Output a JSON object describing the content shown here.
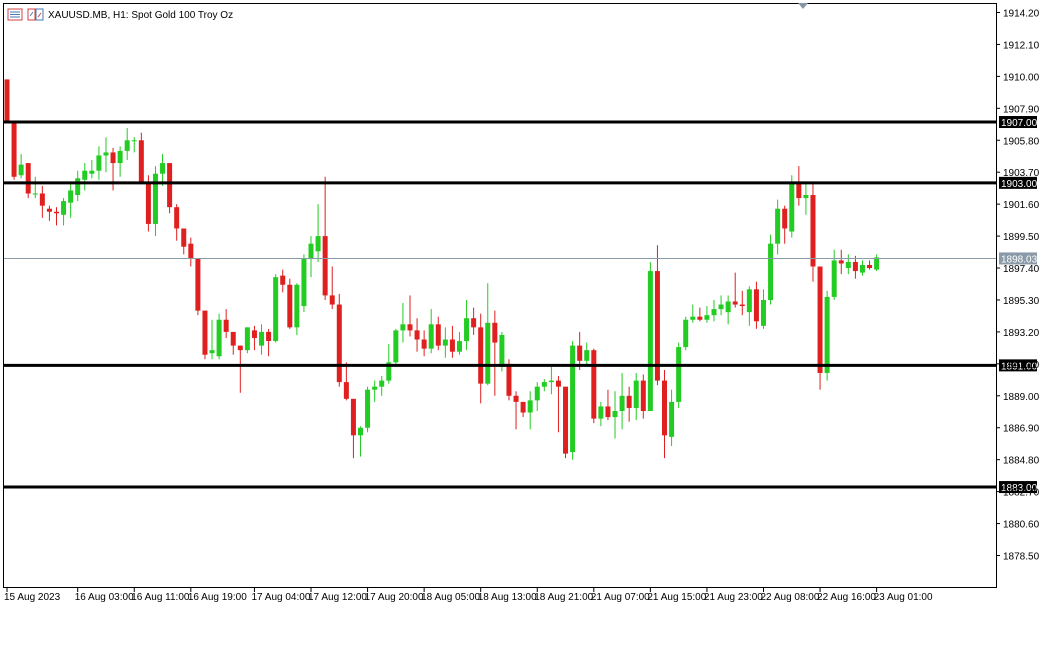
{
  "header": {
    "symbol_title": "XAUUSD.MB, H1:  Spot Gold 100 Troy Oz"
  },
  "colors": {
    "bull": "#22cc22",
    "bear": "#e01f1f",
    "wick_bull": "#22cc22",
    "wick_bear": "#e01f1f",
    "grid_border": "#000000",
    "bid_line": "#8a9aa8"
  },
  "chart_data": {
    "type": "candlestick",
    "title": "XAUUSD.MB, H1:  Spot Gold 100 Troy Oz",
    "ylim": [
      1876.0,
      1915.0
    ],
    "price_ticks": [
      "1914.20",
      "1912.10",
      "1910.00",
      "1907.90",
      "1905.80",
      "1903.70",
      "1901.60",
      "1899.50",
      "1897.40",
      "1895.30",
      "1893.20",
      "1891.10",
      "1889.00",
      "1886.90",
      "1884.80",
      "1882.70",
      "1880.60",
      "1878.50"
    ],
    "time_ticks": [
      {
        "label": "15 Aug 2023",
        "i": 0
      },
      {
        "label": "16 Aug 03:00",
        "i": 10
      },
      {
        "label": "16 Aug 11:00",
        "i": 18
      },
      {
        "label": "16 Aug 19:00",
        "i": 26
      },
      {
        "label": "17 Aug 04:00",
        "i": 35
      },
      {
        "label": "17 Aug 12:00",
        "i": 43
      },
      {
        "label": "17 Aug 20:00",
        "i": 51
      },
      {
        "label": "18 Aug 05:00",
        "i": 59
      },
      {
        "label": "18 Aug 13:00",
        "i": 67
      },
      {
        "label": "18 Aug 21:00",
        "i": 75
      },
      {
        "label": "21 Aug 07:00",
        "i": 83
      },
      {
        "label": "21 Aug 15:00",
        "i": 91
      },
      {
        "label": "21 Aug 23:00",
        "i": 99
      },
      {
        "label": "22 Aug 08:00",
        "i": 107
      },
      {
        "label": "22 Aug 16:00",
        "i": 115
      },
      {
        "label": "23 Aug 01:00",
        "i": 123
      }
    ],
    "horizontal_lines": [
      {
        "price": 1907.0,
        "label": "1907.00",
        "style": "level"
      },
      {
        "price": 1903.0,
        "label": "1903.00",
        "style": "level"
      },
      {
        "price": 1891.0,
        "label": "1891.00",
        "style": "level"
      },
      {
        "price": 1883.0,
        "label": "1883.00",
        "style": "level"
      },
      {
        "price": 1898.03,
        "label": "1898.03",
        "style": "bid"
      }
    ],
    "candles": [
      {
        "o": 1909.8,
        "h": 1909.8,
        "l": 1907.0,
        "c": 1907.0
      },
      {
        "o": 1907.0,
        "h": 1907.0,
        "l": 1903.2,
        "c": 1903.4
      },
      {
        "o": 1903.5,
        "h": 1904.9,
        "l": 1903.3,
        "c": 1904.2
      },
      {
        "o": 1904.3,
        "h": 1904.3,
        "l": 1902.0,
        "c": 1902.3
      },
      {
        "o": 1902.3,
        "h": 1903.4,
        "l": 1902.0,
        "c": 1902.3
      },
      {
        "o": 1902.3,
        "h": 1902.8,
        "l": 1900.7,
        "c": 1901.5
      },
      {
        "o": 1901.3,
        "h": 1901.5,
        "l": 1900.5,
        "c": 1901.1
      },
      {
        "o": 1901.1,
        "h": 1901.4,
        "l": 1900.2,
        "c": 1901.0
      },
      {
        "o": 1900.9,
        "h": 1902.0,
        "l": 1900.2,
        "c": 1901.8
      },
      {
        "o": 1901.7,
        "h": 1903.0,
        "l": 1900.7,
        "c": 1902.5
      },
      {
        "o": 1902.2,
        "h": 1903.8,
        "l": 1901.8,
        "c": 1903.3
      },
      {
        "o": 1903.2,
        "h": 1904.3,
        "l": 1902.5,
        "c": 1903.8
      },
      {
        "o": 1903.6,
        "h": 1904.5,
        "l": 1903.3,
        "c": 1903.8
      },
      {
        "o": 1903.8,
        "h": 1905.4,
        "l": 1903.2,
        "c": 1904.8
      },
      {
        "o": 1904.8,
        "h": 1906.0,
        "l": 1903.7,
        "c": 1905.0
      },
      {
        "o": 1905.0,
        "h": 1905.3,
        "l": 1902.5,
        "c": 1904.3
      },
      {
        "o": 1904.3,
        "h": 1905.4,
        "l": 1903.4,
        "c": 1905.1
      },
      {
        "o": 1905.1,
        "h": 1906.6,
        "l": 1904.5,
        "c": 1905.8
      },
      {
        "o": 1905.8,
        "h": 1906.0,
        "l": 1905.0,
        "c": 1905.8
      },
      {
        "o": 1905.8,
        "h": 1906.3,
        "l": 1902.9,
        "c": 1903.0
      },
      {
        "o": 1903.0,
        "h": 1903.5,
        "l": 1899.8,
        "c": 1900.3
      },
      {
        "o": 1900.3,
        "h": 1904.1,
        "l": 1899.5,
        "c": 1903.6
      },
      {
        "o": 1903.6,
        "h": 1904.9,
        "l": 1902.8,
        "c": 1904.3
      },
      {
        "o": 1904.3,
        "h": 1904.3,
        "l": 1901.0,
        "c": 1901.4
      },
      {
        "o": 1901.4,
        "h": 1901.6,
        "l": 1899.2,
        "c": 1900.0
      },
      {
        "o": 1900.0,
        "h": 1900.0,
        "l": 1898.3,
        "c": 1898.8
      },
      {
        "o": 1899.0,
        "h": 1899.4,
        "l": 1897.5,
        "c": 1898.0
      },
      {
        "o": 1898.0,
        "h": 1898.0,
        "l": 1894.3,
        "c": 1894.6
      },
      {
        "o": 1894.6,
        "h": 1894.6,
        "l": 1891.4,
        "c": 1891.7
      },
      {
        "o": 1891.8,
        "h": 1894.0,
        "l": 1891.4,
        "c": 1892.0
      },
      {
        "o": 1891.6,
        "h": 1894.4,
        "l": 1891.4,
        "c": 1894.0
      },
      {
        "o": 1894.0,
        "h": 1894.7,
        "l": 1892.8,
        "c": 1893.2
      },
      {
        "o": 1893.2,
        "h": 1893.2,
        "l": 1891.7,
        "c": 1892.3
      },
      {
        "o": 1892.3,
        "h": 1892.3,
        "l": 1889.2,
        "c": 1892.0
      },
      {
        "o": 1892.0,
        "h": 1893.5,
        "l": 1891.8,
        "c": 1893.5
      },
      {
        "o": 1893.3,
        "h": 1893.6,
        "l": 1892.0,
        "c": 1892.8
      },
      {
        "o": 1892.3,
        "h": 1893.7,
        "l": 1891.7,
        "c": 1893.2
      },
      {
        "o": 1893.2,
        "h": 1893.4,
        "l": 1891.6,
        "c": 1892.6
      },
      {
        "o": 1892.6,
        "h": 1897.0,
        "l": 1892.5,
        "c": 1896.8
      },
      {
        "o": 1896.9,
        "h": 1897.3,
        "l": 1895.8,
        "c": 1896.3
      },
      {
        "o": 1896.3,
        "h": 1896.7,
        "l": 1893.4,
        "c": 1893.5
      },
      {
        "o": 1893.5,
        "h": 1896.4,
        "l": 1893.0,
        "c": 1896.3
      },
      {
        "o": 1894.9,
        "h": 1898.3,
        "l": 1894.5,
        "c": 1898.0
      },
      {
        "o": 1898.0,
        "h": 1899.5,
        "l": 1896.8,
        "c": 1899.0
      },
      {
        "o": 1898.5,
        "h": 1901.6,
        "l": 1897.8,
        "c": 1899.5
      },
      {
        "o": 1899.5,
        "h": 1903.4,
        "l": 1895.3,
        "c": 1895.6
      },
      {
        "o": 1895.6,
        "h": 1897.5,
        "l": 1894.7,
        "c": 1895.0
      },
      {
        "o": 1895.0,
        "h": 1895.7,
        "l": 1889.6,
        "c": 1889.9
      },
      {
        "o": 1889.9,
        "h": 1891.2,
        "l": 1888.7,
        "c": 1888.8
      },
      {
        "o": 1888.8,
        "h": 1888.8,
        "l": 1884.9,
        "c": 1886.4
      },
      {
        "o": 1886.4,
        "h": 1887.0,
        "l": 1885.0,
        "c": 1886.9
      },
      {
        "o": 1886.9,
        "h": 1889.6,
        "l": 1886.6,
        "c": 1889.4
      },
      {
        "o": 1889.4,
        "h": 1890.0,
        "l": 1888.6,
        "c": 1889.6
      },
      {
        "o": 1889.6,
        "h": 1890.3,
        "l": 1889.0,
        "c": 1890.0
      },
      {
        "o": 1890.0,
        "h": 1892.4,
        "l": 1889.8,
        "c": 1891.2
      },
      {
        "o": 1891.2,
        "h": 1893.4,
        "l": 1890.9,
        "c": 1893.3
      },
      {
        "o": 1893.3,
        "h": 1895.1,
        "l": 1892.5,
        "c": 1893.7
      },
      {
        "o": 1893.7,
        "h": 1895.6,
        "l": 1892.9,
        "c": 1893.3
      },
      {
        "o": 1893.3,
        "h": 1894.1,
        "l": 1891.9,
        "c": 1892.7
      },
      {
        "o": 1892.7,
        "h": 1893.3,
        "l": 1891.6,
        "c": 1892.1
      },
      {
        "o": 1892.1,
        "h": 1894.7,
        "l": 1891.8,
        "c": 1893.7
      },
      {
        "o": 1893.7,
        "h": 1894.2,
        "l": 1892.0,
        "c": 1892.3
      },
      {
        "o": 1892.3,
        "h": 1893.5,
        "l": 1891.5,
        "c": 1892.7
      },
      {
        "o": 1892.7,
        "h": 1893.6,
        "l": 1891.5,
        "c": 1891.9
      },
      {
        "o": 1891.9,
        "h": 1893.2,
        "l": 1891.7,
        "c": 1892.6
      },
      {
        "o": 1892.6,
        "h": 1895.3,
        "l": 1892.0,
        "c": 1894.1
      },
      {
        "o": 1894.1,
        "h": 1894.8,
        "l": 1893.0,
        "c": 1893.5
      },
      {
        "o": 1893.5,
        "h": 1894.4,
        "l": 1888.5,
        "c": 1889.8
      },
      {
        "o": 1889.8,
        "h": 1896.4,
        "l": 1889.7,
        "c": 1893.8
      },
      {
        "o": 1893.8,
        "h": 1894.6,
        "l": 1889.0,
        "c": 1892.5
      },
      {
        "o": 1890.9,
        "h": 1893.2,
        "l": 1890.6,
        "c": 1893.0
      },
      {
        "o": 1891.1,
        "h": 1891.4,
        "l": 1888.7,
        "c": 1889.0
      },
      {
        "o": 1889.0,
        "h": 1889.3,
        "l": 1886.8,
        "c": 1888.6
      },
      {
        "o": 1888.6,
        "h": 1888.6,
        "l": 1887.6,
        "c": 1887.9
      },
      {
        "o": 1887.9,
        "h": 1889.3,
        "l": 1886.8,
        "c": 1888.7
      },
      {
        "o": 1888.7,
        "h": 1889.9,
        "l": 1888.0,
        "c": 1889.6
      },
      {
        "o": 1889.6,
        "h": 1890.1,
        "l": 1889.3,
        "c": 1889.9
      },
      {
        "o": 1889.9,
        "h": 1890.9,
        "l": 1889.1,
        "c": 1890.0
      },
      {
        "o": 1890.0,
        "h": 1890.3,
        "l": 1886.6,
        "c": 1889.6
      },
      {
        "o": 1889.6,
        "h": 1889.6,
        "l": 1884.9,
        "c": 1885.2
      },
      {
        "o": 1885.3,
        "h": 1892.6,
        "l": 1884.8,
        "c": 1892.3
      },
      {
        "o": 1892.3,
        "h": 1893.2,
        "l": 1890.7,
        "c": 1891.3
      },
      {
        "o": 1891.3,
        "h": 1892.5,
        "l": 1891.0,
        "c": 1892.0
      },
      {
        "o": 1892.0,
        "h": 1892.1,
        "l": 1887.2,
        "c": 1887.5
      },
      {
        "o": 1887.5,
        "h": 1888.6,
        "l": 1887.0,
        "c": 1888.3
      },
      {
        "o": 1888.3,
        "h": 1889.4,
        "l": 1887.4,
        "c": 1887.6
      },
      {
        "o": 1887.6,
        "h": 1889.3,
        "l": 1886.2,
        "c": 1888.0
      },
      {
        "o": 1888.0,
        "h": 1890.5,
        "l": 1886.8,
        "c": 1889.0
      },
      {
        "o": 1889.0,
        "h": 1889.6,
        "l": 1887.3,
        "c": 1888.2
      },
      {
        "o": 1888.2,
        "h": 1890.5,
        "l": 1887.4,
        "c": 1890.0
      },
      {
        "o": 1890.0,
        "h": 1890.4,
        "l": 1887.5,
        "c": 1888.0
      },
      {
        "o": 1888.0,
        "h": 1897.8,
        "l": 1888.0,
        "c": 1897.2
      },
      {
        "o": 1897.2,
        "h": 1898.9,
        "l": 1889.7,
        "c": 1890.0
      },
      {
        "o": 1890.0,
        "h": 1890.7,
        "l": 1884.9,
        "c": 1886.4
      },
      {
        "o": 1886.3,
        "h": 1889.4,
        "l": 1885.7,
        "c": 1888.6
      },
      {
        "o": 1888.6,
        "h": 1892.5,
        "l": 1888.2,
        "c": 1892.2
      },
      {
        "o": 1892.2,
        "h": 1894.2,
        "l": 1892.0,
        "c": 1894.0
      },
      {
        "o": 1894.0,
        "h": 1895.0,
        "l": 1893.8,
        "c": 1894.2
      },
      {
        "o": 1894.2,
        "h": 1894.8,
        "l": 1893.9,
        "c": 1894.0
      },
      {
        "o": 1894.0,
        "h": 1894.9,
        "l": 1893.8,
        "c": 1894.3
      },
      {
        "o": 1894.3,
        "h": 1895.3,
        "l": 1893.9,
        "c": 1894.7
      },
      {
        "o": 1894.7,
        "h": 1895.6,
        "l": 1894.3,
        "c": 1895.0
      },
      {
        "o": 1894.5,
        "h": 1895.6,
        "l": 1893.7,
        "c": 1895.2
      },
      {
        "o": 1895.2,
        "h": 1897.1,
        "l": 1894.8,
        "c": 1895.0
      },
      {
        "o": 1895.0,
        "h": 1895.9,
        "l": 1894.3,
        "c": 1894.9
      },
      {
        "o": 1894.5,
        "h": 1896.2,
        "l": 1893.6,
        "c": 1896.0
      },
      {
        "o": 1896.0,
        "h": 1896.5,
        "l": 1893.4,
        "c": 1893.9
      },
      {
        "o": 1893.6,
        "h": 1896.0,
        "l": 1893.4,
        "c": 1895.3
      },
      {
        "o": 1895.3,
        "h": 1899.6,
        "l": 1895.0,
        "c": 1899.0
      },
      {
        "o": 1899.0,
        "h": 1901.9,
        "l": 1898.3,
        "c": 1901.3
      },
      {
        "o": 1901.3,
        "h": 1901.5,
        "l": 1899.0,
        "c": 1900.0
      },
      {
        "o": 1899.8,
        "h": 1903.5,
        "l": 1899.4,
        "c": 1903.0
      },
      {
        "o": 1903.0,
        "h": 1904.1,
        "l": 1901.5,
        "c": 1902.0
      },
      {
        "o": 1902.0,
        "h": 1903.1,
        "l": 1900.9,
        "c": 1902.2
      },
      {
        "o": 1902.2,
        "h": 1903.0,
        "l": 1896.5,
        "c": 1897.5
      },
      {
        "o": 1897.5,
        "h": 1897.5,
        "l": 1889.4,
        "c": 1890.5
      },
      {
        "o": 1890.5,
        "h": 1895.9,
        "l": 1890.0,
        "c": 1895.5
      },
      {
        "o": 1895.5,
        "h": 1898.6,
        "l": 1895.3,
        "c": 1897.9
      },
      {
        "o": 1897.9,
        "h": 1898.6,
        "l": 1897.0,
        "c": 1897.7
      },
      {
        "o": 1897.4,
        "h": 1898.3,
        "l": 1897.0,
        "c": 1897.8
      },
      {
        "o": 1897.8,
        "h": 1898.2,
        "l": 1896.7,
        "c": 1897.2
      },
      {
        "o": 1897.1,
        "h": 1897.9,
        "l": 1896.9,
        "c": 1897.6
      },
      {
        "o": 1897.6,
        "h": 1897.9,
        "l": 1897.3,
        "c": 1897.4
      },
      {
        "o": 1897.3,
        "h": 1898.3,
        "l": 1897.2,
        "c": 1898.1
      }
    ]
  }
}
